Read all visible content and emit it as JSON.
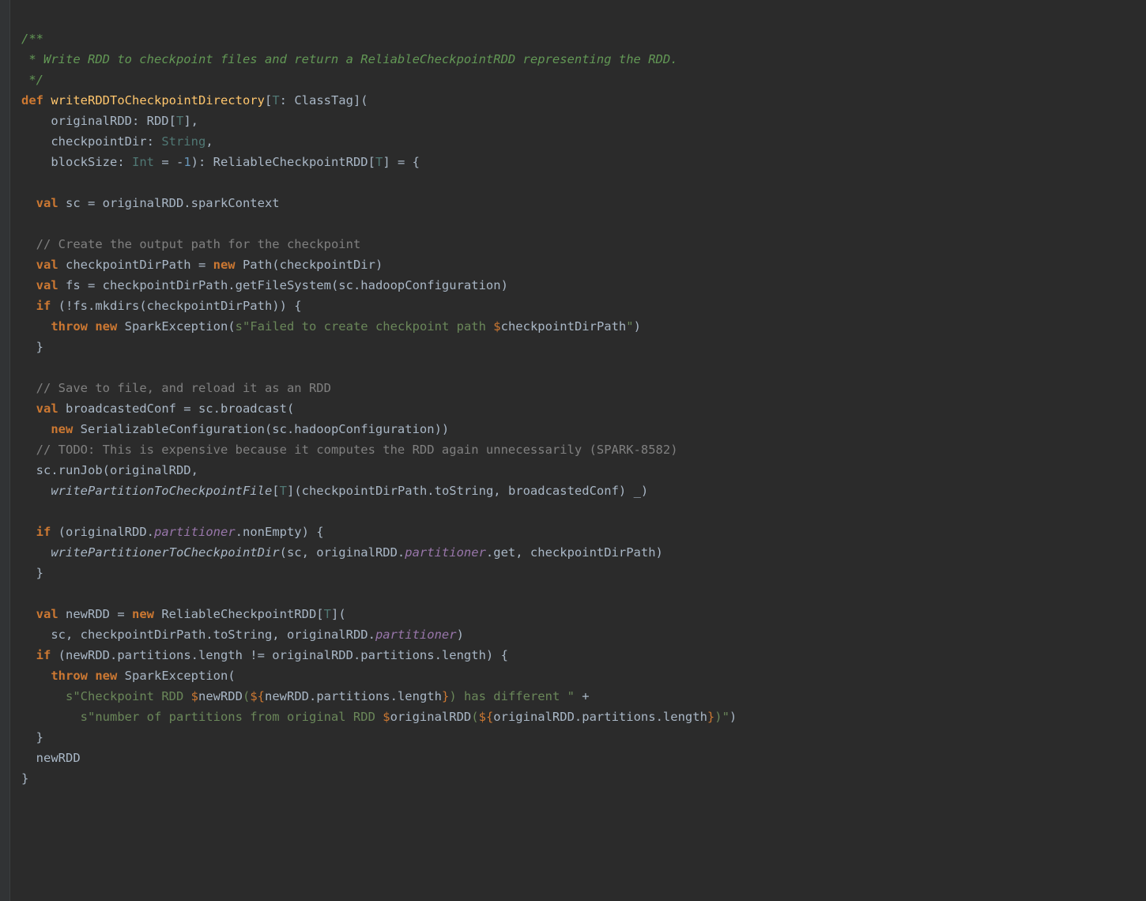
{
  "code": {
    "doc_open": "/**",
    "doc_line": " * Write RDD to checkpoint files and return a ReliableCheckpointRDD representing the RDD.",
    "doc_close": " */",
    "def_kw": "def",
    "def_name": "writeRDDToCheckpointDirectory",
    "def_open": "[",
    "def_tparam": "T",
    "def_classtag": ": ClassTag](",
    "param1_a": "    originalRDD: RDD[",
    "param1_t": "T",
    "param1_b": "],",
    "param2_a": "    checkpointDir: ",
    "param2_t": "String",
    "param2_b": ",",
    "param3_a": "    blockSize: ",
    "param3_t": "Int",
    "param3_eq": " = ",
    "param3_neg": "-",
    "param3_num": "1",
    "param3_b": "): ReliableCheckpointRDD[",
    "param3_t2": "T",
    "param3_c": "] = {",
    "sc_val": "val",
    "sc_rest": " sc = originalRDD.sparkContext",
    "cmt_outpath": "// Create the output path for the checkpoint",
    "cpdir_val": "val",
    "cpdir_a": " checkpointDirPath = ",
    "cpdir_new": "new",
    "cpdir_b": " Path(checkpointDir)",
    "fs_val": "val",
    "fs_rest": " fs = checkpointDirPath.getFileSystem(sc.hadoopConfiguration)",
    "if_kw": "if",
    "if_cond": " (!fs.mkdirs(checkpointDirPath)) {",
    "throw_kw": "throw",
    "throw_sp": " ",
    "throw_new": "new",
    "throw_cls": " SparkException(",
    "throw_s": "s\"Failed to create checkpoint path ",
    "throw_d": "$",
    "throw_var": "checkpointDirPath",
    "throw_end": "\"",
    "throw_paren": ")",
    "brace_close": "}",
    "cmt_save": "// Save to file, and reload it as an RDD",
    "bc_val": "val",
    "bc_a": " broadcastedConf = sc.broadcast(",
    "bc_new": "new",
    "bc_b": " SerializableConfiguration(sc.hadoopConfiguration))",
    "cmt_todo": "// TODO: This is expensive because it computes the RDD again unnecessarily (SPARK-8582)",
    "runjob": "sc.runJob(originalRDD,",
    "wpcf_name": "writePartitionToCheckpointFile",
    "wpcf_open": "[",
    "wpcf_t": "T",
    "wpcf_rest": "](checkpointDirPath.toString, broadcastedConf) _)",
    "if2_kw": "if",
    "if2_a": " (originalRDD.",
    "if2_part": "partitioner",
    "if2_b": ".nonEmpty) {",
    "wpcd_name": "writePartitionerToCheckpointDir",
    "wpcd_a": "(sc, originalRDD.",
    "wpcd_part": "partitioner",
    "wpcd_b": ".get, checkpointDirPath)",
    "newrdd_val": "val",
    "newrdd_a": " newRDD = ",
    "newrdd_new": "new",
    "newrdd_b": " ReliableCheckpointRDD[",
    "newrdd_t": "T",
    "newrdd_c": "](",
    "newrdd_args_a": "  sc, checkpointDirPath.toString, originalRDD.",
    "newrdd_args_part": "partitioner",
    "newrdd_args_b": ")",
    "if3_kw": "if",
    "if3_rest": " (newRDD.partitions.length != originalRDD.partitions.length) {",
    "throw2_kw": "throw",
    "throw2_sp": " ",
    "throw2_new": "new",
    "throw2_cls": " SparkException(",
    "str2a_s": "s\"Checkpoint RDD ",
    "str2a_d1": "$",
    "str2a_v1": "newRDD",
    "str2a_mid1": "(",
    "str2a_d2": "${",
    "str2a_v2": "newRDD.partitions.length",
    "str2a_d2c": "}",
    "str2a_mid2": ") has different \"",
    "str2a_plus": " +",
    "str2b_s": "s\"number of partitions from original RDD ",
    "str2b_d1": "$",
    "str2b_v1": "originalRDD",
    "str2b_mid1": "(",
    "str2b_d2": "${",
    "str2b_v2": "originalRDD.partitions.length",
    "str2b_d2c": "}",
    "str2b_end": ")\"",
    "str2b_paren": ")",
    "ret_newrdd": "newRDD",
    "final_brace": "}"
  }
}
